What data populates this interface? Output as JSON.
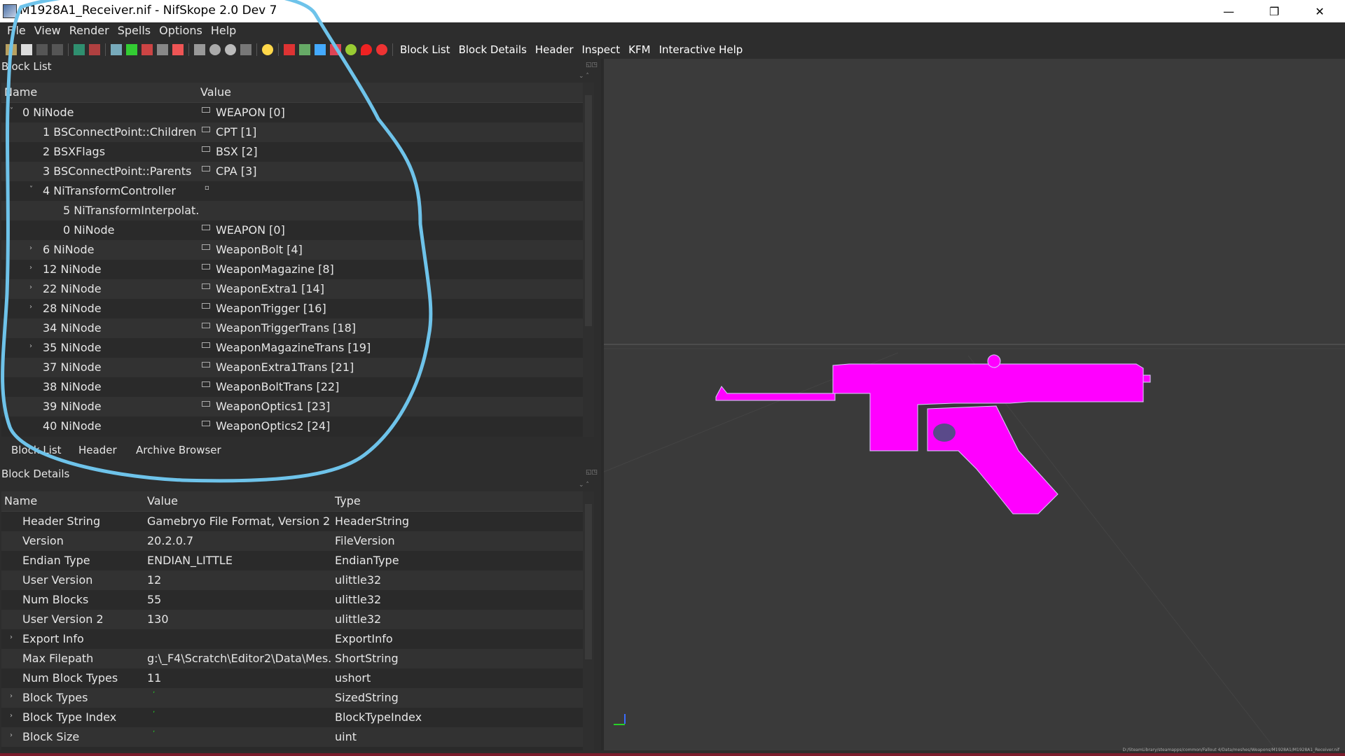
{
  "window": {
    "title": "M1928A1_Receiver.nif - NifSkope 2.0 Dev 7",
    "controls": {
      "minimize": "—",
      "maximize": "❐",
      "close": "✕"
    }
  },
  "menu": [
    "File",
    "View",
    "Render",
    "Spells",
    "Options",
    "Help"
  ],
  "toolbar": {
    "text_buttons": [
      "Block List",
      "Block Details",
      "Header",
      "Inspect",
      "KFM",
      "Interactive Help"
    ]
  },
  "block_list": {
    "title": "Block List",
    "columns": {
      "name": "Name",
      "value": "Value"
    },
    "rows": [
      {
        "name": "0 NiNode",
        "value": "WEAPON [0]"
      },
      {
        "name": "1 BSConnectPoint::Children",
        "value": "CPT [1]"
      },
      {
        "name": "2 BSXFlags",
        "value": "BSX [2]"
      },
      {
        "name": "3 BSConnectPoint::Parents",
        "value": "CPA [3]"
      },
      {
        "name": "4 NiTransformController",
        "value": ""
      },
      {
        "name": "5 NiTransformInterpolat...",
        "value": ""
      },
      {
        "name": "0 NiNode",
        "value": "WEAPON [0]"
      },
      {
        "name": "6 NiNode",
        "value": "WeaponBolt [4]"
      },
      {
        "name": "12 NiNode",
        "value": "WeaponMagazine [8]"
      },
      {
        "name": "22 NiNode",
        "value": "WeaponExtra1 [14]"
      },
      {
        "name": "28 NiNode",
        "value": "WeaponTrigger [16]"
      },
      {
        "name": "34 NiNode",
        "value": "WeaponTriggerTrans [18]"
      },
      {
        "name": "35 NiNode",
        "value": "WeaponMagazineTrans [19]"
      },
      {
        "name": "37 NiNode",
        "value": "WeaponExtra1Trans [21]"
      },
      {
        "name": "38 NiNode",
        "value": "WeaponBoltTrans [22]"
      },
      {
        "name": "39 NiNode",
        "value": "WeaponOptics1 [23]"
      },
      {
        "name": "40 NiNode",
        "value": "WeaponOptics2 [24]"
      }
    ],
    "tabs": [
      "Block List",
      "Header",
      "Archive Browser"
    ]
  },
  "block_details": {
    "title": "Block Details",
    "columns": {
      "name": "Name",
      "value": "Value",
      "type": "Type"
    },
    "rows": [
      {
        "name": "Header String",
        "value": "Gamebryo File Format, Version 20...",
        "type": "HeaderString"
      },
      {
        "name": "Version",
        "value": "20.2.0.7",
        "type": "FileVersion"
      },
      {
        "name": "Endian Type",
        "value": "ENDIAN_LITTLE",
        "type": "EndianType"
      },
      {
        "name": "User Version",
        "value": "12",
        "type": "ulittle32"
      },
      {
        "name": "Num Blocks",
        "value": "55",
        "type": "ulittle32"
      },
      {
        "name": "User Version 2",
        "value": "130",
        "type": "ulittle32"
      },
      {
        "name": "Export Info",
        "value": "",
        "type": "ExportInfo"
      },
      {
        "name": "Max Filepath",
        "value": "g:\\_F4\\Scratch\\Editor2\\Data\\Mes...",
        "type": "ShortString"
      },
      {
        "name": "Num Block Types",
        "value": "11",
        "type": "ushort"
      },
      {
        "name": "Block Types",
        "value": "",
        "type": "SizedString"
      },
      {
        "name": "Block Type Index",
        "value": "",
        "type": "BlockTypeIndex"
      },
      {
        "name": "Block Size",
        "value": "",
        "type": "uint"
      }
    ]
  },
  "status": {
    "path": "D:/SteamLibrary/steamapps/common/Fallout 4/Data/meshes/Weapons/M1928A1/M1928A1_Receiver.nif"
  },
  "colors": {
    "model": "#ff00ff",
    "annotation": "#6ec3ea",
    "accent_green": "#27d127"
  }
}
